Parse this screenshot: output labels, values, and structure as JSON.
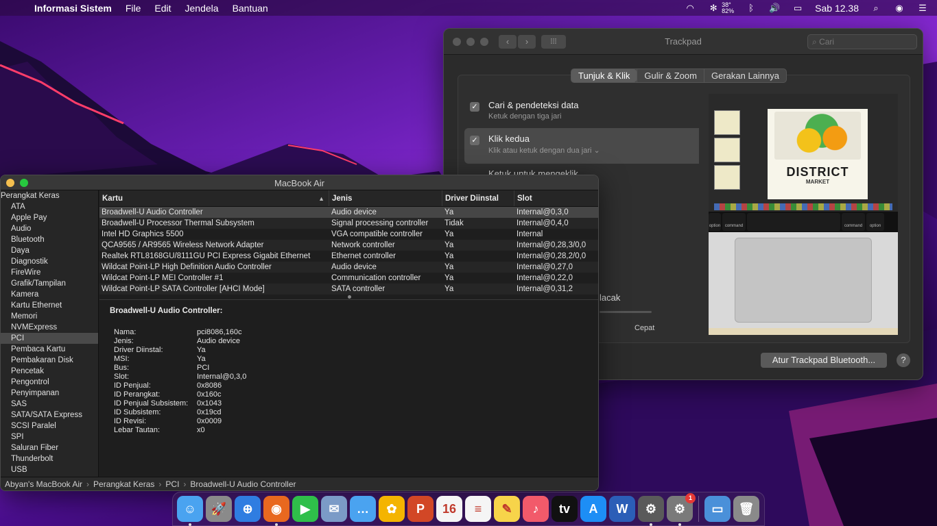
{
  "menubar": {
    "app_name": "Informasi Sistem",
    "menus": [
      "File",
      "Edit",
      "Jendela",
      "Bantuan"
    ],
    "temp_top": "38°",
    "temp_bottom": "82%",
    "clock": "Sab 12.38"
  },
  "trackpad": {
    "window_title": "Trackpad",
    "search_placeholder": "Cari",
    "tabs": [
      "Tunjuk & Klik",
      "Gulir & Zoom",
      "Gerakan Lainnya"
    ],
    "options": [
      {
        "title": "Cari & pendeteksi data",
        "subtitle": "Ketuk dengan tiga jari",
        "checked": true
      },
      {
        "title": "Klik kedua",
        "subtitle": "Klik atau ketuk dengan dua jari ⌄",
        "checked": true
      }
    ],
    "partial_option": "Ketuk untuk mengeklik",
    "tracking_label": "lacak",
    "speed_fast": "Cepat",
    "preview": {
      "district": "DISTRICT",
      "market": "MARKET",
      "key_command_left": "command",
      "key_command_right": "command",
      "key_option_left": "option",
      "key_option_right": "option"
    },
    "bluetooth_button": "Atur Trackpad Bluetooth...",
    "help_button": "?"
  },
  "sysinfo": {
    "window_title": "MacBook Air",
    "sidebar_root": "Perangkat Keras",
    "sidebar_items": [
      "ATA",
      "Apple Pay",
      "Audio",
      "Bluetooth",
      "Daya",
      "Diagnostik",
      "FireWire",
      "Grafik/Tampilan",
      "Kamera",
      "Kartu Ethernet",
      "Memori",
      "NVMExpress",
      "PCI",
      "Pembaca Kartu",
      "Pembakaran Disk",
      "Pencetak",
      "Pengontrol",
      "Penyimpanan",
      "SAS",
      "SATA/SATA Express",
      "SCSI Paralel",
      "SPI",
      "Saluran Fiber",
      "Thunderbolt",
      "USB"
    ],
    "selected_sidebar": "PCI",
    "columns": [
      "Kartu",
      "Jenis",
      "Driver Diinstal",
      "Slot"
    ],
    "rows": [
      [
        "Broadwell-U Audio Controller",
        "Audio device",
        "Ya",
        "Internal@0,3,0"
      ],
      [
        "Broadwell-U Processor Thermal Subsystem",
        "Signal processing controller",
        "Tidak",
        "Internal@0,4,0"
      ],
      [
        "Intel HD Graphics 5500",
        "VGA compatible controller",
        "Ya",
        "Internal"
      ],
      [
        "QCA9565 / AR9565 Wireless Network Adapter",
        "Network controller",
        "Ya",
        "Internal@0,28,3/0,0"
      ],
      [
        "Realtek RTL8168GU/8111GU PCI Express Gigabit Ethernet",
        "Ethernet controller",
        "Ya",
        "Internal@0,28,2/0,0"
      ],
      [
        "Wildcat Point-LP High Definition Audio Controller",
        "Audio device",
        "Ya",
        "Internal@0,27,0"
      ],
      [
        "Wildcat Point-LP MEI Controller #1",
        "Communication controller",
        "Ya",
        "Internal@0,22,0"
      ],
      [
        "Wildcat Point-LP SATA Controller [AHCI Mode]",
        "SATA controller",
        "Ya",
        "Internal@0,31,2"
      ]
    ],
    "detail_title": "Broadwell-U Audio Controller:",
    "detail": [
      [
        "Nama:",
        "pci8086,160c"
      ],
      [
        "Jenis:",
        "Audio device"
      ],
      [
        "Driver Diinstal:",
        "Ya"
      ],
      [
        "MSI:",
        "Ya"
      ],
      [
        "Bus:",
        "PCI"
      ],
      [
        "Slot:",
        "Internal@0,3,0"
      ],
      [
        "ID Penjual:",
        "0x8086"
      ],
      [
        "ID Perangkat:",
        "0x160c"
      ],
      [
        "ID Penjual Subsistem:",
        "0x1043"
      ],
      [
        "ID Subsistem:",
        "0x19cd"
      ],
      [
        "ID Revisi:",
        "0x0009"
      ],
      [
        "Lebar Tautan:",
        "x0"
      ]
    ],
    "path": [
      "Abyan's MacBook Air",
      "Perangkat Keras",
      "PCI",
      "Broadwell-U Audio Controller"
    ],
    "path_sep": "›"
  },
  "dock": {
    "items": [
      {
        "name": "finder-icon",
        "color": "#4aa3f0",
        "glyph": "☺",
        "running": true
      },
      {
        "name": "launchpad-icon",
        "color": "#8a8a8a",
        "glyph": "🚀",
        "running": false
      },
      {
        "name": "safari-icon",
        "color": "#2f7de1",
        "glyph": "⊕",
        "running": false
      },
      {
        "name": "firefox-icon",
        "color": "#e8681f",
        "glyph": "◉",
        "running": true
      },
      {
        "name": "facetime-icon",
        "color": "#2fbf4a",
        "glyph": "▶",
        "running": false
      },
      {
        "name": "preview-icon",
        "color": "#7b9bc7",
        "glyph": "✉",
        "running": false
      },
      {
        "name": "messages-icon",
        "color": "#4aa3f0",
        "glyph": "…",
        "running": false
      },
      {
        "name": "photos-icon",
        "color": "#f4b400",
        "glyph": "✿",
        "running": false
      },
      {
        "name": "powerpoint-icon",
        "color": "#d24726",
        "glyph": "P",
        "running": false
      },
      {
        "name": "calendar-icon",
        "color": "#f5f5f5",
        "glyph": "16",
        "running": false
      },
      {
        "name": "reminders-icon",
        "color": "#f5f5f5",
        "glyph": "≡",
        "running": false
      },
      {
        "name": "notes-icon",
        "color": "#f7d44a",
        "glyph": "✎",
        "running": false
      },
      {
        "name": "music-icon",
        "color": "#f25a6a",
        "glyph": "♪",
        "running": false
      },
      {
        "name": "tv-icon",
        "color": "#111111",
        "glyph": "tv",
        "running": false
      },
      {
        "name": "app-store-icon",
        "color": "#1d8ef5",
        "glyph": "A",
        "running": false
      },
      {
        "name": "word-icon",
        "color": "#2b5eb7",
        "glyph": "W",
        "running": false
      },
      {
        "name": "system-information-icon",
        "color": "#5a5a5a",
        "glyph": "⚙",
        "running": true
      },
      {
        "name": "system-preferences-icon",
        "color": "#7a7a7a",
        "glyph": "⚙",
        "running": true,
        "badge": "1"
      }
    ],
    "trailing": [
      {
        "name": "folder-icon",
        "color": "#4a90d9",
        "glyph": "▭"
      },
      {
        "name": "trash-icon",
        "color": "#8a8a8a",
        "glyph": "🗑"
      }
    ]
  }
}
